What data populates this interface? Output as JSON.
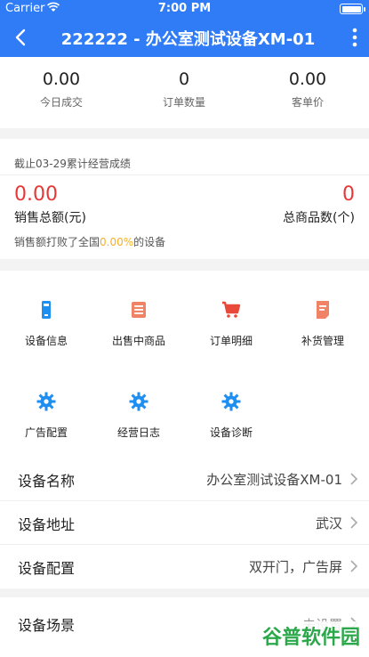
{
  "status": {
    "carrier": "Carrier",
    "time": "7:00 PM"
  },
  "nav": {
    "title": "222222 - 办公室测试设备XM-01"
  },
  "stats": [
    {
      "value": "0.00",
      "label": "今日成交"
    },
    {
      "value": "0",
      "label": "订单数量"
    },
    {
      "value": "0.00",
      "label": "客单价"
    }
  ],
  "performance": {
    "header": "截止03-29累计经营成绩",
    "sales_value": "0.00",
    "sales_label": "销售总额(元)",
    "items_value": "0",
    "items_label": "总商品数(个)",
    "beat_prefix": "销售额打败了全国",
    "beat_pct": "0.00%",
    "beat_suffix": "的设备"
  },
  "grid": [
    {
      "label": "设备信息",
      "icon": "device-icon",
      "color": "#1e8ff0"
    },
    {
      "label": "出售中商品",
      "icon": "list-icon",
      "color": "#f08366"
    },
    {
      "label": "订单明细",
      "icon": "cart-icon",
      "color": "#e8493b"
    },
    {
      "label": "补货管理",
      "icon": "document-icon",
      "color": "#f08366"
    },
    {
      "label": "广告配置",
      "icon": "gear-icon",
      "color": "#1e8ff0"
    },
    {
      "label": "经营日志",
      "icon": "gear-icon",
      "color": "#1e8ff0"
    },
    {
      "label": "设备诊断",
      "icon": "gear-icon",
      "color": "#1e8ff0"
    }
  ],
  "list": [
    {
      "key": "设备名称",
      "value": "办公室测试设备XM-01"
    },
    {
      "key": "设备地址",
      "value": "武汉"
    },
    {
      "key": "设备配置",
      "value": "双开门，广告屏"
    }
  ],
  "scene": {
    "key": "设备场景",
    "value": "未设置"
  },
  "watermark": "谷普软件园",
  "colors": {
    "primary": "#2f7cf6",
    "accent_red": "#e53935",
    "accent_yellow": "#f5b026"
  }
}
